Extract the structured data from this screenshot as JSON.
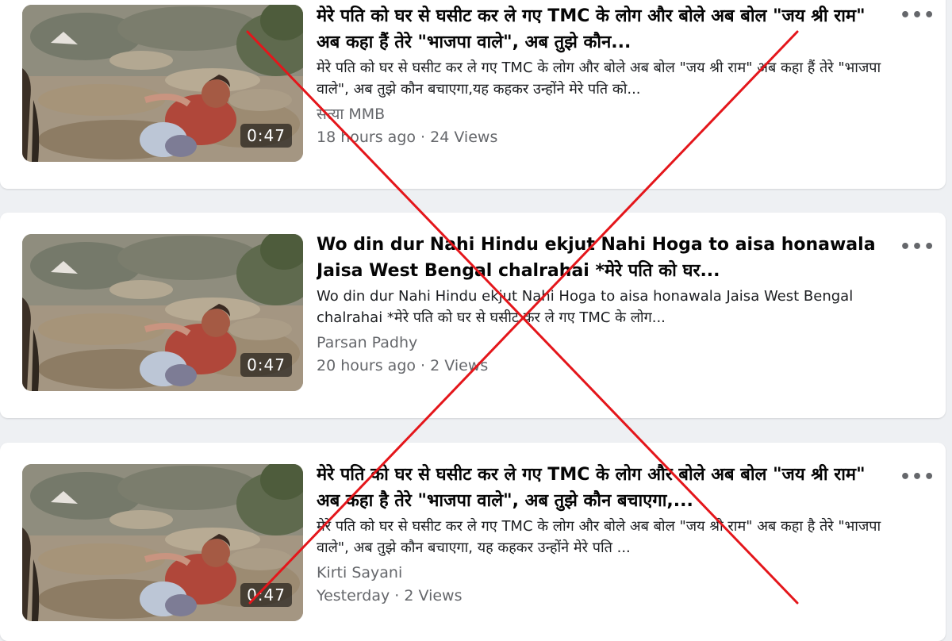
{
  "videos": [
    {
      "title": "मेरे पति को घर से घसीट कर ले गए TMC के लोग और बोले अब बोल \"जय श्री राम\" अब कहा हैं तेरे \"भाजपा वाले\", अब तुझे कौन...",
      "description": "मेरे पति को घर से घसीट कर ले गए TMC के लोग और बोले अब बोल \"जय श्री राम\" अब कहा हैं तेरे \"भाजपा वाले\", अब तुझे कौन बचाएगा,यह कहकर उन्होंने मेरे पति को...",
      "author": "सत्या MMB",
      "time": "18 hours ago",
      "separator": " · ",
      "views": "24 Views",
      "duration": "0:47",
      "more_icon": "more-options-icon"
    },
    {
      "title": "Wo din dur Nahi Hindu ekjut Nahi Hoga to aisa honawala Jaisa West Bengal chalrahai *मेरे पति को घर...",
      "description": "Wo din dur Nahi Hindu ekjut Nahi Hoga to aisa honawala Jaisa West Bengal chalrahai *मेरे पति को घर से घसीट कर ले गए TMC के लोग...",
      "author": "Parsan Padhy",
      "time": "20 hours ago",
      "separator": " · ",
      "views": "2 Views",
      "duration": "0:47",
      "more_icon": "more-options-icon"
    },
    {
      "title": "मेरे पति को घर से घसीट कर ले गए TMC के लोग और बोले अब बोल \"जय श्री राम\" अब कहा है तेरे \"भाजपा वाले\", अब तुझे कौन बचाएगा,...",
      "description": "मेरे पति को घर से घसीट कर ले गए TMC के लोग और बोले अब बोल \"जय श्री राम\" अब कहा है तेरे \"भाजपा वाले\", अब तुझे कौन बचाएगा, यह कहकर उन्होंने मेरे पति ...",
      "author": "Kirti Sayani",
      "time": "Yesterday",
      "separator": " · ",
      "views": "2 Views",
      "duration": "0:47",
      "more_icon": "more-options-icon"
    }
  ],
  "overlay": {
    "type": "red-x-cross",
    "color": "#e4161b"
  },
  "colors": {
    "background": "#eef0f3",
    "card": "#ffffff",
    "title": "#050505",
    "secondary": "#65676b"
  }
}
